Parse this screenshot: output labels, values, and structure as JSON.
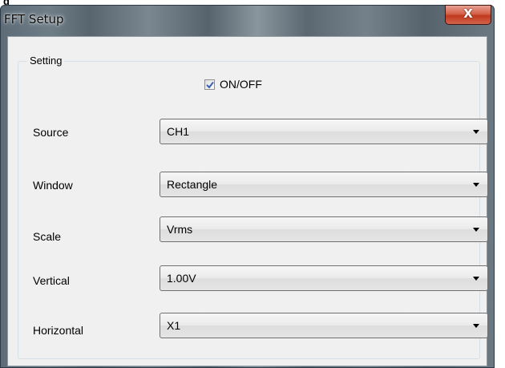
{
  "background": {
    "fragment_text": "g"
  },
  "window": {
    "title": "FFT Setup",
    "close_glyph": "X"
  },
  "setting_group": {
    "label": "Setting",
    "enable": {
      "label": "ON/OFF",
      "checked": true
    },
    "fields": [
      {
        "label": "Source",
        "value": "CH1"
      },
      {
        "label": "Window",
        "value": "Rectangle"
      },
      {
        "label": "Scale",
        "value": "Vrms"
      },
      {
        "label": "Vertical",
        "value": "1.00V"
      },
      {
        "label": "Horizontal",
        "value": "X1"
      }
    ]
  },
  "colors": {
    "close_button": "#c7432b",
    "dialog_body": "#f0f0f0",
    "check_mark": "#3a5fb0"
  }
}
